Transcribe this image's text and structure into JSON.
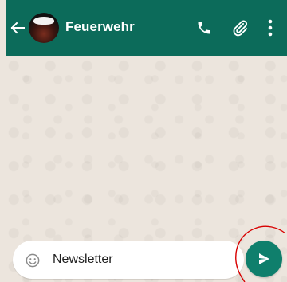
{
  "header": {
    "title": "Feuerwehr",
    "icons": {
      "back": "arrow-left-icon",
      "call": "phone-icon",
      "attach": "paperclip-icon",
      "menu": "more-vertical-icon"
    }
  },
  "composer": {
    "text": "Newsletter",
    "emoji_icon": "emoji-icon",
    "send_icon": "send-icon"
  },
  "colors": {
    "header": "#0c6b5a",
    "chat_background": "#ece5dd",
    "send_button": "#0f7f6c",
    "annotation": "#d80000"
  }
}
